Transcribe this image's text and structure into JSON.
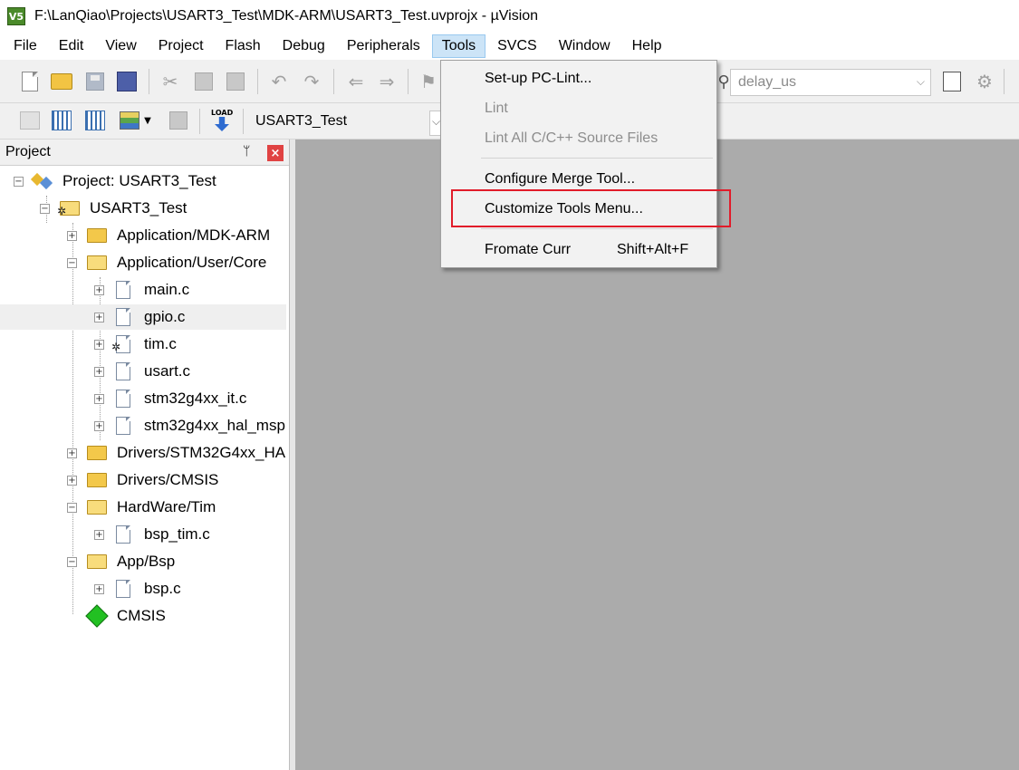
{
  "window": {
    "title": "F:\\LanQiao\\Projects\\USART3_Test\\MDK-ARM\\USART3_Test.uvprojx - µVision",
    "logo_text": "V5"
  },
  "menubar": {
    "items": [
      {
        "label": "File"
      },
      {
        "label": "Edit"
      },
      {
        "label": "View"
      },
      {
        "label": "Project"
      },
      {
        "label": "Flash"
      },
      {
        "label": "Debug"
      },
      {
        "label": "Peripherals"
      },
      {
        "label": "Tools",
        "active": true
      },
      {
        "label": "SVCS"
      },
      {
        "label": "Window"
      },
      {
        "label": "Help"
      }
    ]
  },
  "toolbar": {
    "find_combo_value": "delay_us",
    "target_name": "USART3_Test",
    "load_label": "LOAD"
  },
  "tools_menu": {
    "items": [
      {
        "label": "Set-up PC-Lint...",
        "enabled": true
      },
      {
        "label": "Lint",
        "enabled": false
      },
      {
        "label": "Lint All C/C++ Source Files",
        "enabled": false
      },
      {
        "label": "Configure Merge Tool...",
        "enabled": true
      },
      {
        "label": "Customize Tools Menu...",
        "enabled": true,
        "highlighted": true
      },
      {
        "label": "Fromate Curr",
        "shortcut": "Shift+Alt+F",
        "enabled": true
      }
    ]
  },
  "project_panel": {
    "title": "Project",
    "pin_glyph": "📌",
    "close_glyph": "×",
    "tree": [
      {
        "label": "Project: USART3_Test",
        "level": 0,
        "icon": "project-icon",
        "expander": "−"
      },
      {
        "label": "USART3_Test",
        "level": 1,
        "icon": "target-folder-icon",
        "expander": "−"
      },
      {
        "label": "Application/MDK-ARM",
        "level": 2,
        "icon": "folder-icon",
        "expander": "+"
      },
      {
        "label": "Application/User/Core",
        "level": 2,
        "icon": "folder-open-icon",
        "expander": "−"
      },
      {
        "label": "main.c",
        "level": 3,
        "icon": "file-icon",
        "expander": "+"
      },
      {
        "label": "gpio.c",
        "level": 3,
        "icon": "file-icon",
        "expander": "+",
        "hover": true
      },
      {
        "label": "tim.c",
        "level": 3,
        "icon": "file-gear-icon",
        "expander": "+"
      },
      {
        "label": "usart.c",
        "level": 3,
        "icon": "file-icon",
        "expander": "+"
      },
      {
        "label": "stm32g4xx_it.c",
        "level": 3,
        "icon": "file-icon",
        "expander": "+"
      },
      {
        "label": "stm32g4xx_hal_msp",
        "level": 3,
        "icon": "file-icon",
        "expander": "+"
      },
      {
        "label": "Drivers/STM32G4xx_HA",
        "level": 2,
        "icon": "folder-icon",
        "expander": "+"
      },
      {
        "label": "Drivers/CMSIS",
        "level": 2,
        "icon": "folder-icon",
        "expander": "+"
      },
      {
        "label": "HardWare/Tim",
        "level": 2,
        "icon": "folder-open-icon",
        "expander": "−"
      },
      {
        "label": "bsp_tim.c",
        "level": 3,
        "icon": "file-icon",
        "expander": "+"
      },
      {
        "label": "App/Bsp",
        "level": 2,
        "icon": "folder-open-icon",
        "expander": "−"
      },
      {
        "label": "bsp.c",
        "level": 3,
        "icon": "file-icon",
        "expander": "+"
      },
      {
        "label": "CMSIS",
        "level": 2,
        "icon": "cmsis-icon",
        "expander": ""
      }
    ]
  },
  "colors": {
    "menu_active_bg": "#cce4f7",
    "editor_bg": "#ababab",
    "highlight_box": "#e11c2a",
    "toolbar_bg": "#f0f0f0"
  }
}
